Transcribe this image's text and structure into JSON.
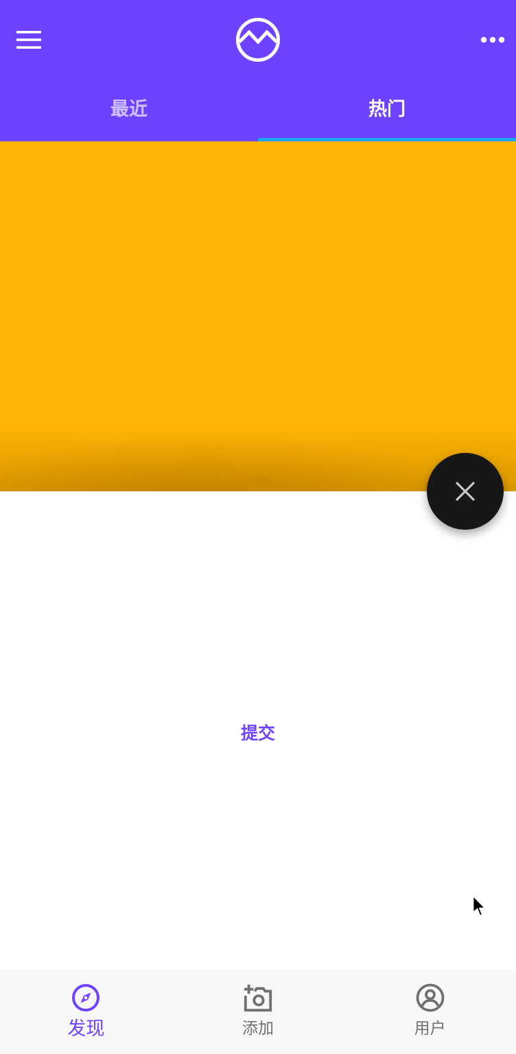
{
  "header": {
    "menu_icon": "hamburger-menu-icon",
    "logo_icon": "wave-circle-logo",
    "more_icon": "more-dots-icon",
    "tabs": [
      {
        "label": "最近",
        "active": false
      },
      {
        "label": "热门",
        "active": true
      }
    ]
  },
  "hero": {
    "color": "#ffb607"
  },
  "content": {
    "submit_label": "提交"
  },
  "fab": {
    "icon": "close-icon"
  },
  "bottom_nav": {
    "items": [
      {
        "label": "发现",
        "icon": "compass-icon",
        "active": true
      },
      {
        "label": "添加",
        "icon": "add-photo-icon",
        "active": false
      },
      {
        "label": "用户",
        "icon": "user-icon",
        "active": false
      }
    ]
  },
  "colors": {
    "primary": "#6f42ff",
    "accent": "#1ea7f2",
    "fab": "#171717",
    "nav_background": "#f7f7f7"
  }
}
